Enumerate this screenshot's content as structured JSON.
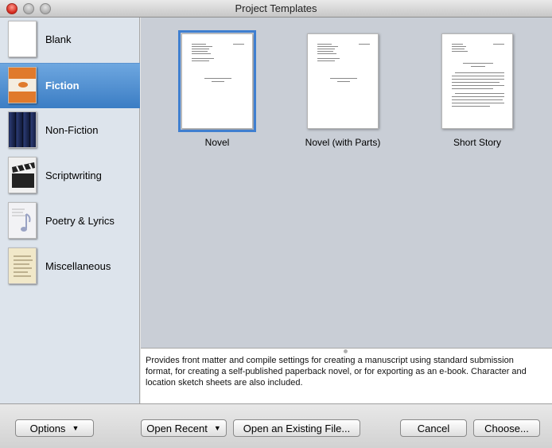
{
  "window": {
    "title": "Project Templates"
  },
  "sidebar": {
    "items": [
      {
        "label": "Blank",
        "icon": "blank-page-icon"
      },
      {
        "label": "Fiction",
        "icon": "fiction-book-icon",
        "selected": true
      },
      {
        "label": "Non-Fiction",
        "icon": "bookshelf-icon"
      },
      {
        "label": "Scriptwriting",
        "icon": "clapperboard-icon"
      },
      {
        "label": "Poetry & Lyrics",
        "icon": "music-note-icon"
      },
      {
        "label": "Miscellaneous",
        "icon": "notes-page-icon"
      }
    ]
  },
  "templates": [
    {
      "label": "Novel",
      "selected": true
    },
    {
      "label": "Novel (with Parts)"
    },
    {
      "label": "Short Story"
    }
  ],
  "description": "Provides front matter and compile settings for creating a manuscript using standard submission format, for creating a self-published paperback novel, or for exporting as an e-book. Character and location sketch sheets are also included.",
  "buttons": {
    "options": "Options",
    "open_recent": "Open Recent",
    "open_existing": "Open an Existing File...",
    "cancel": "Cancel",
    "choose": "Choose..."
  },
  "colors": {
    "selection": "#3b7dc4",
    "sidebar_bg": "#dde4ec",
    "template_bg": "#c9ced6"
  }
}
